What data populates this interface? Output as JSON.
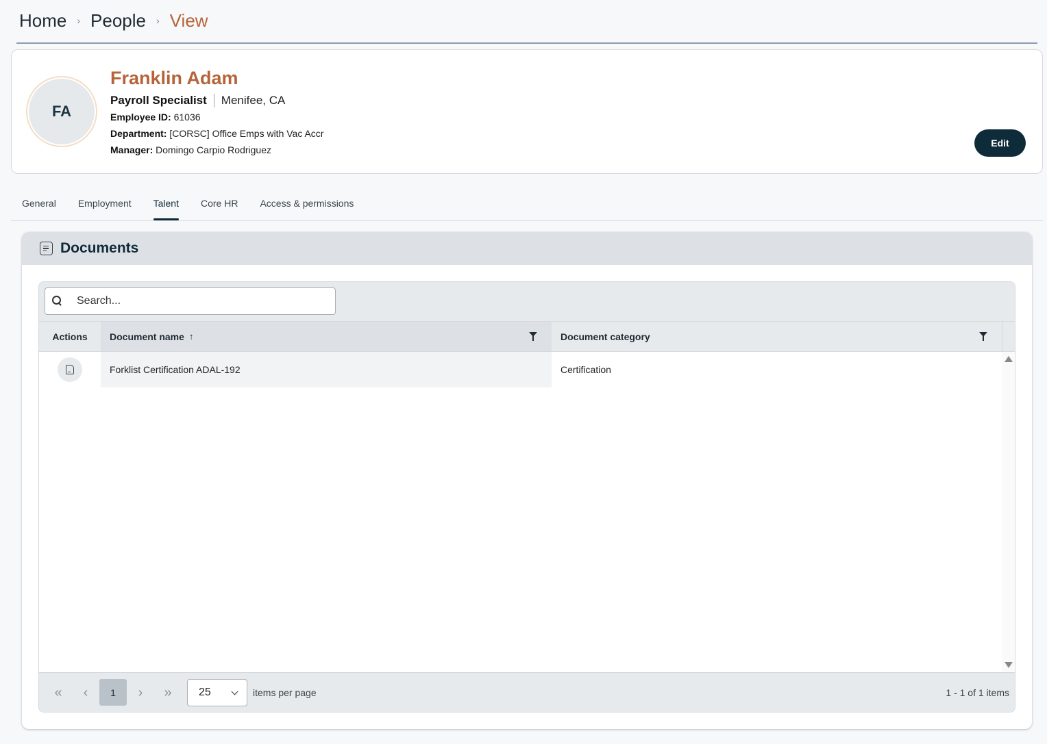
{
  "breadcrumb": {
    "home": "Home",
    "people": "People",
    "current": "View",
    "separator": "›"
  },
  "profile": {
    "initials": "FA",
    "name": "Franklin Adam",
    "job_title": "Payroll Specialist",
    "location": "Menifee, CA",
    "employee_id_label": "Employee ID:",
    "employee_id": "61036",
    "department_label": "Department:",
    "department": "[CORSC] Office Emps with Vac Accr",
    "manager_label": "Manager:",
    "manager": "Domingo Carpio Rodriguez",
    "edit_label": "Edit"
  },
  "tabs": [
    {
      "label": "General",
      "active": false
    },
    {
      "label": "Employment",
      "active": false
    },
    {
      "label": "Talent",
      "active": true
    },
    {
      "label": "Core HR",
      "active": false
    },
    {
      "label": "Access & permissions",
      "active": false
    }
  ],
  "documents": {
    "title": "Documents",
    "search_placeholder": "Search...",
    "columns": {
      "actions": "Actions",
      "name": "Document name",
      "sort_indicator": "↑",
      "category": "Document category"
    },
    "rows": [
      {
        "name": "Forklist Certification ADAL-192",
        "category": "Certification"
      }
    ],
    "pager": {
      "first": "«",
      "prev": "‹",
      "page": "1",
      "next": "›",
      "last": "»",
      "per_page": "25",
      "per_page_label": "items per page",
      "info": "1 - 1 of 1 items"
    }
  },
  "colors": {
    "accent": "#b5643a",
    "primary_dark": "#0e2b3a"
  }
}
